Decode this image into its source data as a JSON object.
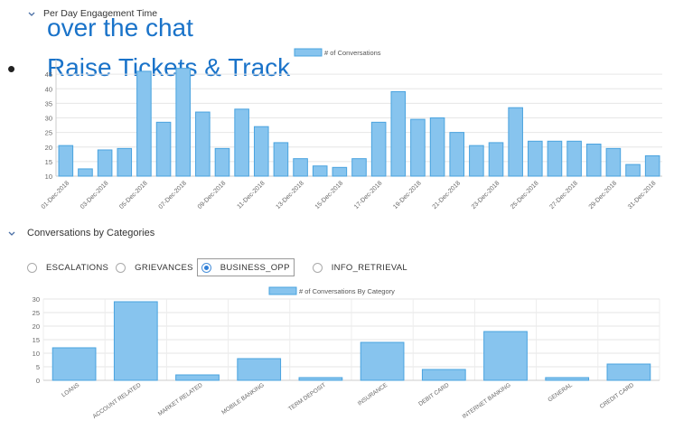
{
  "overlay": {
    "line1": "over the chat",
    "line2": "Raise Tickets & Track",
    "bullet": "•"
  },
  "section1": {
    "title": "Per Day Engagement Time"
  },
  "section2": {
    "title": "Conversations by Categories"
  },
  "radios": [
    {
      "label": "ESCALATIONS",
      "selected": false
    },
    {
      "label": "GRIEVANCES",
      "selected": false
    },
    {
      "label": "BUSINESS_OPP",
      "selected": true
    },
    {
      "label": "INFO_RETRIEVAL",
      "selected": false
    }
  ],
  "colors": {
    "bar": "#87c4ee",
    "bar_stroke": "#4aa3df",
    "accent": "#1a73c9"
  },
  "chart_data": [
    {
      "type": "bar",
      "legend": "# of Conversations",
      "ylim": [
        10,
        50
      ],
      "yticks": [
        10,
        15,
        20,
        25,
        30,
        35,
        40,
        45
      ],
      "xticks": [
        "01-Dec-2018",
        "03-Dec-2018",
        "05-Dec-2018",
        "07-Dec-2018",
        "09-Dec-2018",
        "11-Dec-2018",
        "13-Dec-2018",
        "15-Dec-2018",
        "17-Dec-2018",
        "19-Dec-2018",
        "21-Dec-2018",
        "23-Dec-2018",
        "25-Dec-2018",
        "27-Dec-2018",
        "29-Dec-2018",
        "31-Dec-2018"
      ],
      "values": [
        20.5,
        12.5,
        19,
        19.5,
        46,
        28.5,
        47,
        32,
        19.5,
        33,
        27,
        21.5,
        16,
        13.5,
        13,
        16,
        28.5,
        39,
        29.5,
        30,
        25,
        20.5,
        21.5,
        33.5,
        22,
        22,
        22,
        21,
        19.5,
        14,
        17
      ]
    },
    {
      "type": "bar",
      "legend": "# of Conversations By Category",
      "ylim": [
        0,
        30
      ],
      "yticks": [
        0,
        5,
        10,
        15,
        20,
        25,
        30
      ],
      "categories": [
        "LOANS",
        "ACCOUNT RELATED",
        "MARKET RELATED",
        "MOBILE BANKING",
        "TERM DEPOSIT",
        "INSURANCE",
        "DEBIT CARD",
        "INTERNET BANKING",
        "GENERAL",
        "CREDIT CARD"
      ],
      "values": [
        12,
        29,
        2,
        8,
        1,
        14,
        4,
        18,
        1,
        6
      ]
    }
  ]
}
